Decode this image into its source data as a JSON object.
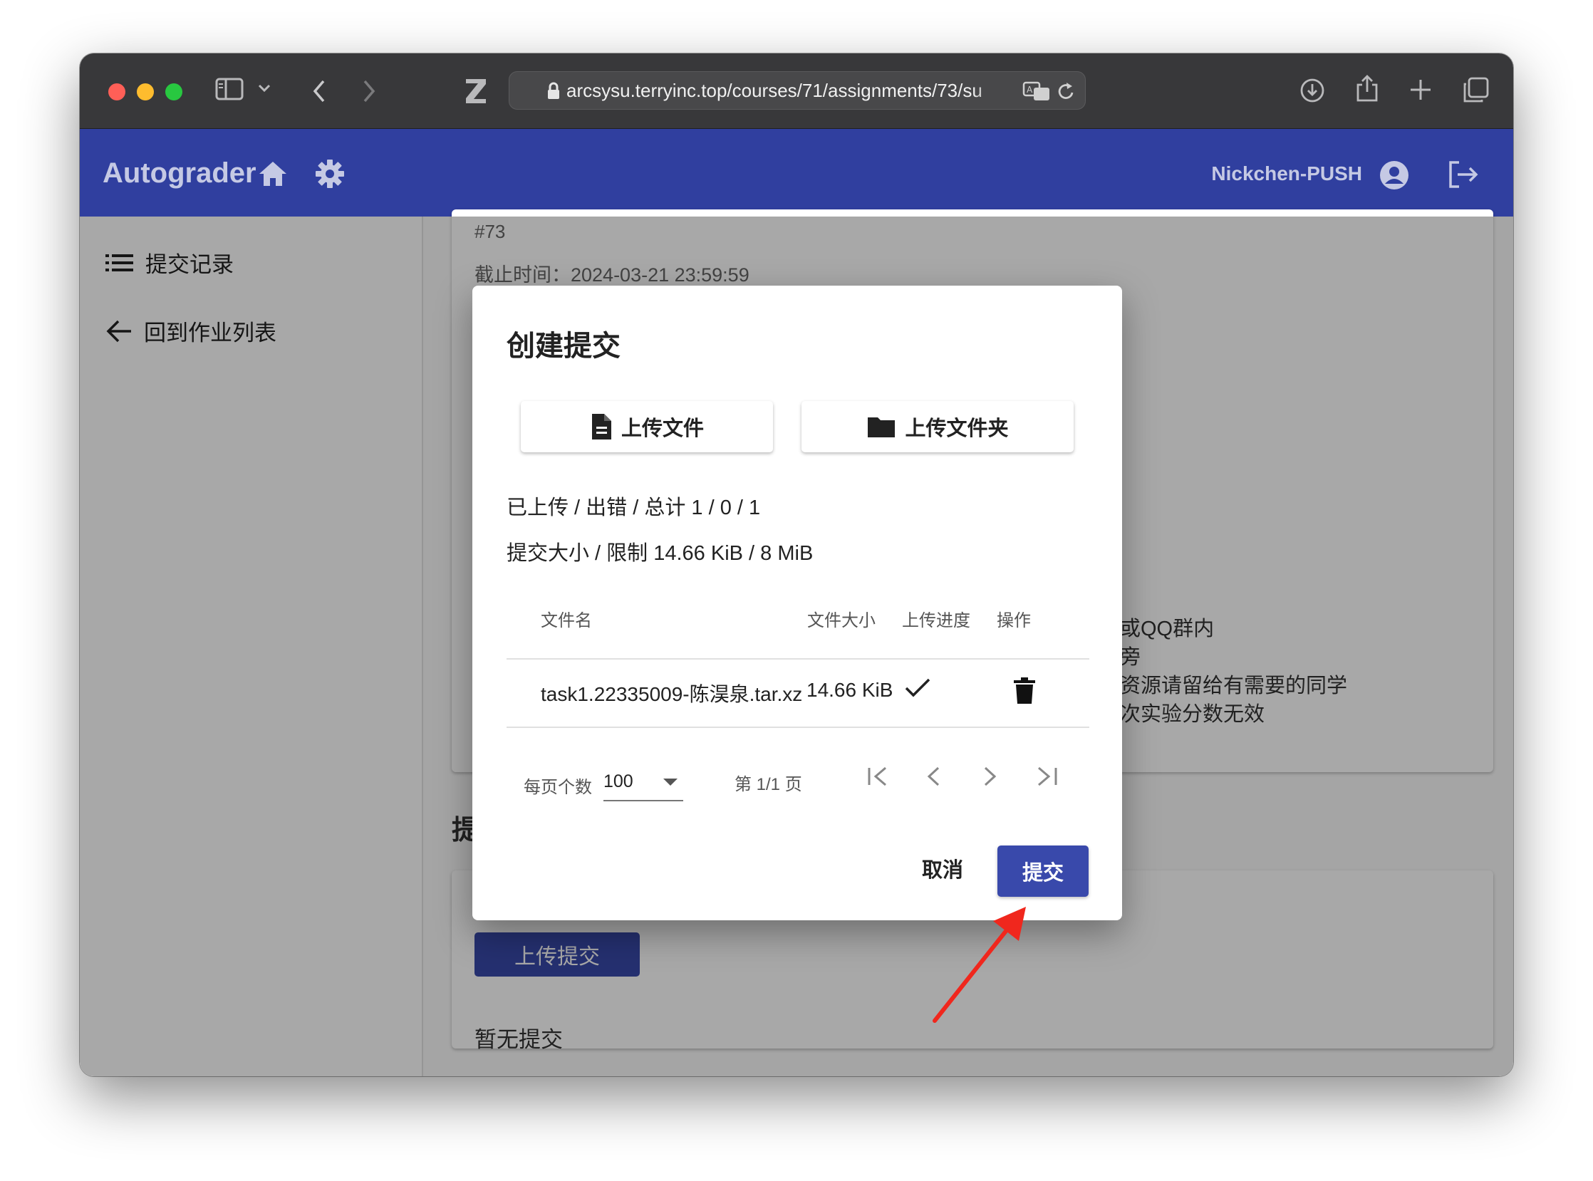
{
  "browser": {
    "url": "arcsysu.terryinc.top/courses/71/assignments/73/su"
  },
  "app": {
    "title": "Autograder",
    "username": "Nickchen-PUSH"
  },
  "sidebar": {
    "items": [
      {
        "label": "提交记录",
        "icon": "list-icon"
      },
      {
        "label": "回到作业列表",
        "icon": "arrow-left-icon"
      }
    ]
  },
  "background": {
    "assignment_id": "#73",
    "deadline": "截止时间：2024-03-21 23:59:59",
    "notes": [
      "或QQ群内",
      "旁",
      "资源请留给有需要的同学",
      "次实验分数无效"
    ],
    "section_title": "提",
    "upload_button": "上传提交",
    "no_submissions": "暂无提交"
  },
  "dialog": {
    "title": "创建提交",
    "upload_file_label": "上传文件",
    "upload_folder_label": "上传文件夹",
    "upload_stats": "已上传 / 出错 / 总计 1 / 0 / 1",
    "size_stats": "提交大小 / 限制 14.66 KiB / 8 MiB",
    "table": {
      "headers": {
        "name": "文件名",
        "size": "文件大小",
        "progress": "上传进度",
        "actions": "操作"
      },
      "rows": [
        {
          "name": "task1.22335009-陈淏泉.tar.xz",
          "size": "14.66 KiB",
          "progress": "done"
        }
      ]
    },
    "pagination": {
      "per_page_label": "每页个数",
      "per_page_value": "100",
      "page_info": "第 1/1 页"
    },
    "cancel_label": "取消",
    "submit_label": "提交"
  },
  "colors": {
    "titlebar": "#38383a",
    "appbar": "#303f9f",
    "primary_button": "#3949ab",
    "annotation_arrow": "#f0271d"
  }
}
